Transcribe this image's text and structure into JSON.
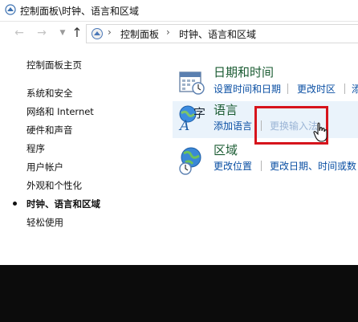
{
  "window": {
    "title": "控制面板\\时钟、语言和区域"
  },
  "address_bar": {
    "back_icon": "arrow-left-icon",
    "forward_icon": "arrow-right-icon",
    "recent_icon": "chevron-down-icon",
    "up_icon": "arrow-up-icon",
    "breadcrumbs": [
      "控制面板",
      "时钟、语言和区域"
    ]
  },
  "sidebar": {
    "home": "控制面板主页",
    "items": [
      {
        "label": "系统和安全"
      },
      {
        "label": "网络和 Internet"
      },
      {
        "label": "硬件和声音"
      },
      {
        "label": "程序"
      },
      {
        "label": "用户帐户"
      },
      {
        "label": "外观和个性化"
      },
      {
        "label": "时钟、语言和区域",
        "active": true
      },
      {
        "label": "轻松使用"
      }
    ]
  },
  "categories": [
    {
      "title": "日期和时间",
      "icon": "calendar-clock-icon",
      "links": [
        "设置时间和日期",
        "更改时区",
        "添"
      ]
    },
    {
      "title": "语言",
      "icon": "language-icon",
      "links": [
        "添加语言",
        "更换输入法"
      ]
    },
    {
      "title": "区域",
      "icon": "globe-clock-icon",
      "links": [
        "更改位置",
        "更改日期、时间或数"
      ]
    }
  ],
  "colors": {
    "link": "#0a4fa3",
    "category_title": "#1a5b32",
    "highlight_box": "#d6141c",
    "selected_bg": "#eaf3fb"
  }
}
